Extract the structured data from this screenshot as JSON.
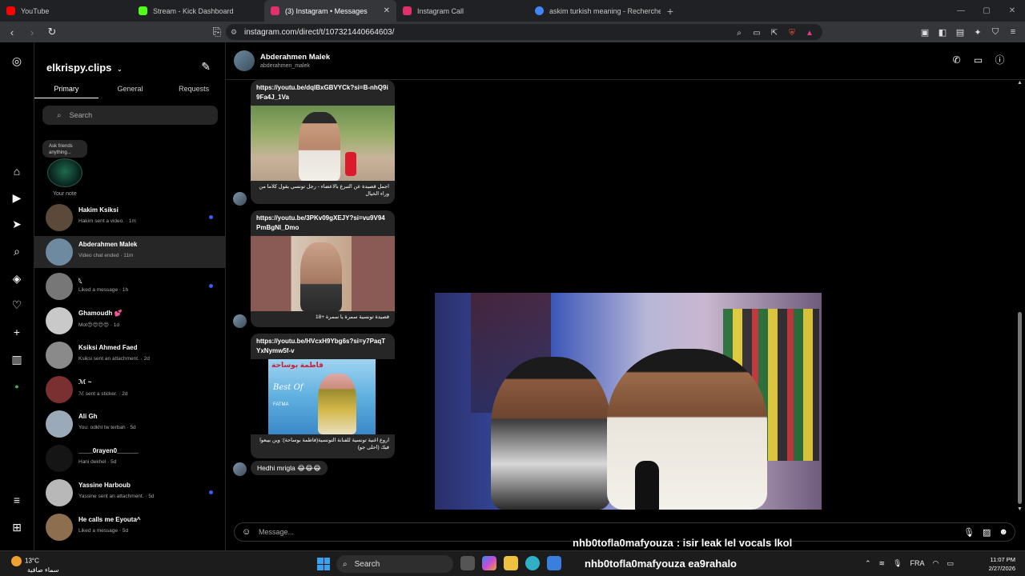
{
  "browser": {
    "tabs": [
      {
        "title": "YouTube",
        "color": "#ff0000",
        "active": false
      },
      {
        "title": "Stream - Kick Dashboard",
        "color": "#53fc18",
        "active": false
      },
      {
        "title": "(3) Instagram • Messages",
        "color": "#e1306c",
        "active": true
      },
      {
        "title": "Instagram Call",
        "color": "#e1306c",
        "active": false
      },
      {
        "title": "askim turkish meaning - Recherche G",
        "color": "#4285f4",
        "active": false
      }
    ],
    "url": "instagram.com/direct/t/107321440664603/"
  },
  "inbox": {
    "username": "elkrispy.clips",
    "tabs": [
      "Primary",
      "General",
      "Requests"
    ],
    "search_placeholder": "Search",
    "note_text": "Ask friends anything...",
    "note_label": "Your note",
    "conversations": [
      {
        "name": "Hakim Ksiksi",
        "last": "Hakim sent a video. · 1m",
        "unread": true,
        "selected": false,
        "color": "#5b4a3a"
      },
      {
        "name": "Abderahmen Malek",
        "last": "Video chat ended · 11m",
        "unread": false,
        "selected": true,
        "color": "#6d8aa0"
      },
      {
        "name": "𓆩",
        "last": "Liked a message · 1h",
        "unread": true,
        "selected": false,
        "color": "#777777"
      },
      {
        "name": "Ghamoudh 💕",
        "last": "Mot😍😍😍😍 · 1d",
        "unread": false,
        "selected": false,
        "color": "#c9c9c9"
      },
      {
        "name": "Ksiksi Ahmed Faed",
        "last": "Ksiksi sent an attachment. · 2d",
        "unread": false,
        "selected": false,
        "color": "#8a8a8a"
      },
      {
        "name": "ℳ ~",
        "last": "ℳ sent a sticker. · 2d",
        "unread": false,
        "selected": false,
        "color": "#7a3030"
      },
      {
        "name": "Ali Gh",
        "last": "You: odkhl tw terbah · 5d",
        "unread": false,
        "selected": false,
        "color": "#9aaab8"
      },
      {
        "name": "____0rayen0______",
        "last": "Hani dekhel · 5d",
        "unread": false,
        "selected": false,
        "color": "#151515"
      },
      {
        "name": "Yassine Harboub",
        "last": "Yassine sent an attachment. · 5d",
        "unread": true,
        "selected": false,
        "color": "#b8b8b8"
      },
      {
        "name": "He calls me Eyouta^",
        "last": "Liked a message · 5d",
        "unread": false,
        "selected": false,
        "color": "#8d6e4f"
      }
    ]
  },
  "chat": {
    "name": "Abderahmen Malek",
    "username": "abderahmen_malek",
    "messages": [
      {
        "link": "https://youtu.be/dqlBxGBVYCk?si=B-nhQ9i9Fa4J_1Va",
        "caption": "اجمل قصيدة عن التبرع بالاعضاء - رجل تونسي يقول كلاما من وراء الخيال"
      },
      {
        "link": "https://youtu.be/3PKv09gXEJY?si=vu9V94PmBgNl_Dmo",
        "caption": "قصيدة تونسية سمرة يا سمرة +18"
      },
      {
        "link": "https://youtu.be/HVcxH9Ybg6s?si=y7PaqTYxNymw5f-v",
        "caption": "اروع اغنية تونسية للفنانة التونسية(فاطمة بوساحة): وين بيبعوا فيك (احلى جو)"
      }
    ],
    "text_message": "Hedhi mrigla 😂😂😂",
    "composer_placeholder": "Message..."
  },
  "thumb_text": {
    "thumb3_title": "فاطمة بوساحة",
    "thumb3_sub": "Best Of",
    "thumb3_name": "FATMA"
  },
  "overlay": {
    "chat_user": "nhb0tofla0mafyouza",
    "chat_message": ": isir leak lel vocals lkol",
    "taskbar_name": "nhb0tofla0mafyouza ea9rahalo"
  },
  "taskbar": {
    "temp": "13°C",
    "weather": "سماء صافية",
    "search": "Search",
    "lang": "FRA",
    "time": "11:07 PM",
    "date": "2/27/2026"
  }
}
